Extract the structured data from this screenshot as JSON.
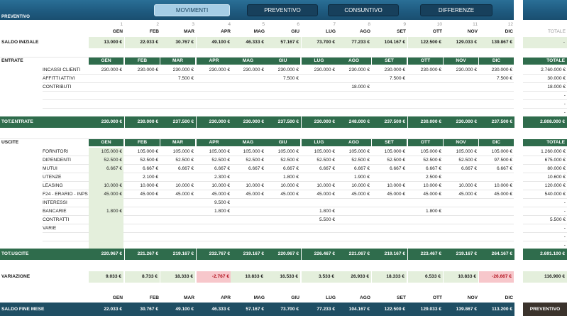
{
  "brand": "PREVENTIVO",
  "tabs": [
    {
      "label": "MOVIMENTI",
      "active": true
    },
    {
      "label": "PREVENTIVO",
      "active": false
    },
    {
      "label": "CONSUNTIVO",
      "active": false
    },
    {
      "label": "DIFFERENZE",
      "active": false
    }
  ],
  "month_numbers": [
    "1",
    "2",
    "3",
    "4",
    "5",
    "6",
    "7",
    "8",
    "9",
    "10",
    "11",
    "12"
  ],
  "months": [
    "GEN",
    "FEB",
    "MAR",
    "APR",
    "MAG",
    "GIU",
    "LUG",
    "AGO",
    "SET",
    "OTT",
    "NOV",
    "DIC"
  ],
  "totale_label": "TOTALE",
  "saldo_iniziale": {
    "label": "SALDO INIZIALE",
    "values": [
      "13.000 €",
      "22.033 €",
      "30.767 €",
      "49.100 €",
      "46.333 €",
      "57.167 €",
      "73.700 €",
      "77.233 €",
      "104.167 €",
      "122.500 €",
      "129.033 €",
      "139.867 €"
    ],
    "total": "-"
  },
  "entrate": {
    "label": "ENTRATE",
    "rows": [
      {
        "label": "INCASSI CLIENTI",
        "values": [
          "230.000 €",
          "230.000 €",
          "230.000 €",
          "230.000 €",
          "230.000 €",
          "230.000 €",
          "230.000 €",
          "230.000 €",
          "230.000 €",
          "230.000 €",
          "230.000 €",
          "230.000 €"
        ],
        "total": "2.760.000 €"
      },
      {
        "label": "AFFITTI ATTIVI",
        "values": [
          "",
          "",
          "7.500 €",
          "",
          "",
          "7.500 €",
          "",
          "",
          "7.500 €",
          "",
          "",
          "7.500 €"
        ],
        "total": "30.000 €"
      },
      {
        "label": "CONTRIBUTI",
        "values": [
          "",
          "",
          "",
          "",
          "",
          "",
          "",
          "18.000 €",
          "",
          "",
          "",
          ""
        ],
        "total": "18.000 €"
      },
      {
        "label": "",
        "values": [
          "",
          "",
          "",
          "",
          "",
          "",
          "",
          "",
          "",
          "",
          "",
          ""
        ],
        "total": "-"
      },
      {
        "label": "",
        "values": [
          "",
          "",
          "",
          "",
          "",
          "",
          "",
          "",
          "",
          "",
          "",
          ""
        ],
        "total": "-"
      },
      {
        "label": "",
        "values": [
          "",
          "",
          "",
          "",
          "",
          "",
          "",
          "",
          "",
          "",
          "",
          ""
        ],
        "total": "-"
      }
    ],
    "total_label": "TOT.ENTRATE",
    "totals": [
      "230.000 €",
      "230.000 €",
      "237.500 €",
      "230.000 €",
      "230.000 €",
      "237.500 €",
      "230.000 €",
      "248.000 €",
      "237.500 €",
      "230.000 €",
      "230.000 €",
      "237.500 €"
    ],
    "grand_total": "2.808.000 €"
  },
  "uscite": {
    "label": "USCITE",
    "rows": [
      {
        "label": "FORNITORI",
        "values": [
          "105.000 €",
          "105.000 €",
          "105.000 €",
          "105.000 €",
          "105.000 €",
          "105.000 €",
          "105.000 €",
          "105.000 €",
          "105.000 €",
          "105.000 €",
          "105.000 €",
          "105.000 €"
        ],
        "total": "1.260.000 €"
      },
      {
        "label": "DIPENDENTI",
        "values": [
          "52.500 €",
          "52.500 €",
          "52.500 €",
          "52.500 €",
          "52.500 €",
          "52.500 €",
          "52.500 €",
          "52.500 €",
          "52.500 €",
          "52.500 €",
          "52.500 €",
          "97.500 €"
        ],
        "total": "675.000 €"
      },
      {
        "label": "MUTUI",
        "values": [
          "6.667 €",
          "6.667 €",
          "6.667 €",
          "6.667 €",
          "6.667 €",
          "6.667 €",
          "6.667 €",
          "6.667 €",
          "6.667 €",
          "6.667 €",
          "6.667 €",
          "6.667 €"
        ],
        "total": "80.000 €"
      },
      {
        "label": "UTENZE",
        "values": [
          "",
          "2.100 €",
          "",
          "2.300 €",
          "",
          "1.800 €",
          "",
          "1.900 €",
          "",
          "2.500 €",
          "",
          ""
        ],
        "total": "10.600 €"
      },
      {
        "label": "LEASING",
        "values": [
          "10.000 €",
          "10.000 €",
          "10.000 €",
          "10.000 €",
          "10.000 €",
          "10.000 €",
          "10.000 €",
          "10.000 €",
          "10.000 €",
          "10.000 €",
          "10.000 €",
          "10.000 €"
        ],
        "total": "120.000 €"
      },
      {
        "label": "F24 - ERARIO - INPS",
        "values": [
          "45.000 €",
          "45.000 €",
          "45.000 €",
          "45.000 €",
          "45.000 €",
          "45.000 €",
          "45.000 €",
          "45.000 €",
          "45.000 €",
          "45.000 €",
          "45.000 €",
          "45.000 €"
        ],
        "total": "540.000 €"
      },
      {
        "label": "INTERESSI",
        "values": [
          "",
          "",
          "",
          "9.500 €",
          "",
          "",
          "",
          "",
          "",
          "",
          "",
          ""
        ],
        "total": "-"
      },
      {
        "label": "BANCARIE",
        "values": [
          "1.800 €",
          "",
          "",
          "1.800 €",
          "",
          "",
          "1.800 €",
          "",
          "",
          "1.800 €",
          "",
          ""
        ],
        "total": "-"
      },
      {
        "label": "CONTRATTI",
        "values": [
          "",
          "",
          "",
          "",
          "",
          "",
          "5.500 €",
          "",
          "",
          "",
          "",
          ""
        ],
        "total": "5.500 €"
      },
      {
        "label": "VARIE",
        "values": [
          "",
          "",
          "",
          "",
          "",
          "",
          "",
          "",
          "",
          "",
          "",
          ""
        ],
        "total": "-"
      },
      {
        "label": "",
        "values": [
          "",
          "",
          "",
          "",
          "",
          "",
          "",
          "",
          "",
          "",
          "",
          ""
        ],
        "total": "-"
      },
      {
        "label": "",
        "values": [
          "",
          "",
          "",
          "",
          "",
          "",
          "",
          "",
          "",
          "",
          "",
          ""
        ],
        "total": "-"
      }
    ],
    "total_label": "TOT.USCITE",
    "totals": [
      "220.967 €",
      "221.267 €",
      "219.167 €",
      "232.767 €",
      "219.167 €",
      "220.967 €",
      "226.467 €",
      "221.067 €",
      "219.167 €",
      "223.467 €",
      "219.167 €",
      "264.167 €"
    ],
    "grand_total": "2.691.100 €"
  },
  "variazione": {
    "label": "VARIAZIONE",
    "values": [
      "9.033 €",
      "8.733 €",
      "18.333 €",
      "-2.767 €",
      "10.833 €",
      "16.533 €",
      "3.533 €",
      "26.933 €",
      "18.333 €",
      "6.533 €",
      "10.833 €",
      "-26.667 €"
    ],
    "negative": [
      false,
      false,
      false,
      true,
      false,
      false,
      false,
      false,
      false,
      false,
      false,
      true
    ],
    "total": "116.900 €"
  },
  "saldo_fine": {
    "label": "SALDO FINE MESE",
    "values": [
      "22.033 €",
      "30.767 €",
      "49.100 €",
      "46.333 €",
      "57.167 €",
      "73.700 €",
      "77.233 €",
      "104.167 €",
      "122.500 €",
      "129.033 €",
      "139.867 €",
      "113.200 €"
    ],
    "badge": "PREVENTIVO"
  },
  "colors": {
    "header_green": "#2f6c4c",
    "light_green": "#e4efdc",
    "top_blue": "#1f5b80",
    "bottom_bar": "#1f4e63",
    "negative": "#f7c7cb"
  }
}
